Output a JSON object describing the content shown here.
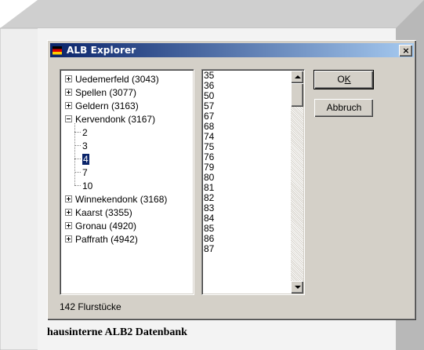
{
  "window": {
    "title": "ALB Explorer",
    "close_label": "×",
    "icon": "app-flag-icon"
  },
  "tree": {
    "items": [
      {
        "label": "Uedemerfeld (3043)",
        "expanded": false
      },
      {
        "label": "Spellen (3077)",
        "expanded": false
      },
      {
        "label": "Geldern (3163)",
        "expanded": false
      },
      {
        "label": "Kervendonk (3167)",
        "expanded": true,
        "children": [
          "2",
          "3",
          "4",
          "7",
          "10"
        ],
        "selected_child": "4"
      },
      {
        "label": "Winnekendonk (3168)",
        "expanded": false
      },
      {
        "label": "Kaarst (3355)",
        "expanded": false
      },
      {
        "label": "Gronau (4920)",
        "expanded": false
      },
      {
        "label": "Paffrath (4942)",
        "expanded": false
      }
    ]
  },
  "list": {
    "items": [
      "35",
      "36",
      "50",
      "57",
      "67",
      "68",
      "74",
      "75",
      "76",
      "79",
      "80",
      "81",
      "82",
      "83",
      "84",
      "85",
      "86",
      "87"
    ]
  },
  "buttons": {
    "ok_label": "OK",
    "cancel_label": "Abbruch"
  },
  "status_text": "142 Flurstücke",
  "caption": "hausinterne ALB2 Datenbank"
}
